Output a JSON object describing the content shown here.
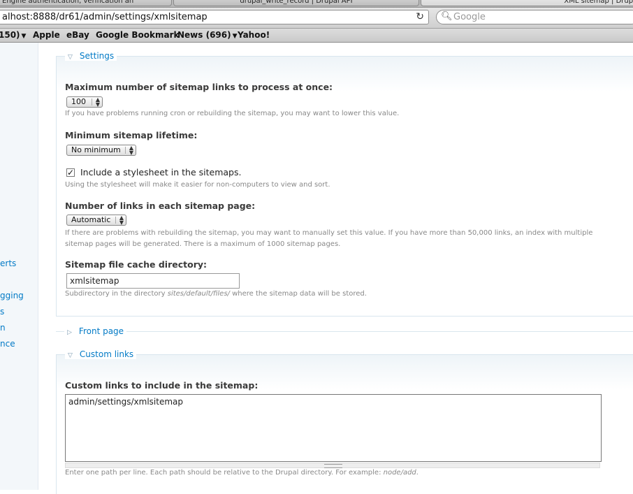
{
  "browser": {
    "tabs": [
      {
        "title": "Engine authentication, verification an"
      },
      {
        "title": "drupal_write_record | Drupal API"
      },
      {
        "title": "XML sitemap | Drupal"
      }
    ],
    "address": "alhost:8888/dr61/admin/settings/xmlsitemap",
    "search_placeholder": "Google",
    "bookmarks": [
      {
        "label": "150)"
      },
      {
        "label": "Apple"
      },
      {
        "label": "eBay"
      },
      {
        "label": "Google Bookmark"
      },
      {
        "label": "News (696)"
      },
      {
        "label": "Yahoo!"
      }
    ]
  },
  "sidebar": {
    "items": [
      {
        "label": "erts"
      },
      {
        "label": "gging"
      },
      {
        "label": "s"
      },
      {
        "label": "n"
      },
      {
        "label": "nce"
      }
    ]
  },
  "settings": {
    "legend": "Settings",
    "max_links_label": "Maximum number of sitemap links to process at once:",
    "max_links_value": "100",
    "max_links_desc": "If you have problems running cron or rebuilding the sitemap, you may want to lower this value.",
    "lifetime_label": "Minimum sitemap lifetime:",
    "lifetime_value": "No minimum",
    "stylesheet_label": "Include a stylesheet in the sitemaps.",
    "stylesheet_checked": true,
    "stylesheet_desc": "Using the stylesheet will make it easier for non-computers to view and sort.",
    "chunk_label": "Number of links in each sitemap page:",
    "chunk_value": "Automatic",
    "chunk_desc_1": "If there are problems with rebuilding the sitemap, you may want to manually set this value. If you have more than 50,000 links, an index with multiple",
    "chunk_desc_2": "sitemap pages will be generated. There is a maximum of 1000 sitemap pages.",
    "cache_label": "Sitemap file cache directory:",
    "cache_value": "xmlsitemap",
    "cache_desc_pre": "Subdirectory in the directory ",
    "cache_desc_path": "sites/default/files/",
    "cache_desc_post": " where the sitemap data will be stored."
  },
  "front_page": {
    "legend": "Front page"
  },
  "custom_links": {
    "legend": "Custom links",
    "label": "Custom links to include in the sitemap:",
    "value": "admin/settings/xmlsitemap",
    "desc_pre": "Enter one path per line. Each path should be relative to the Drupal directory. For example: ",
    "desc_example": "node/add",
    "desc_post": "."
  }
}
